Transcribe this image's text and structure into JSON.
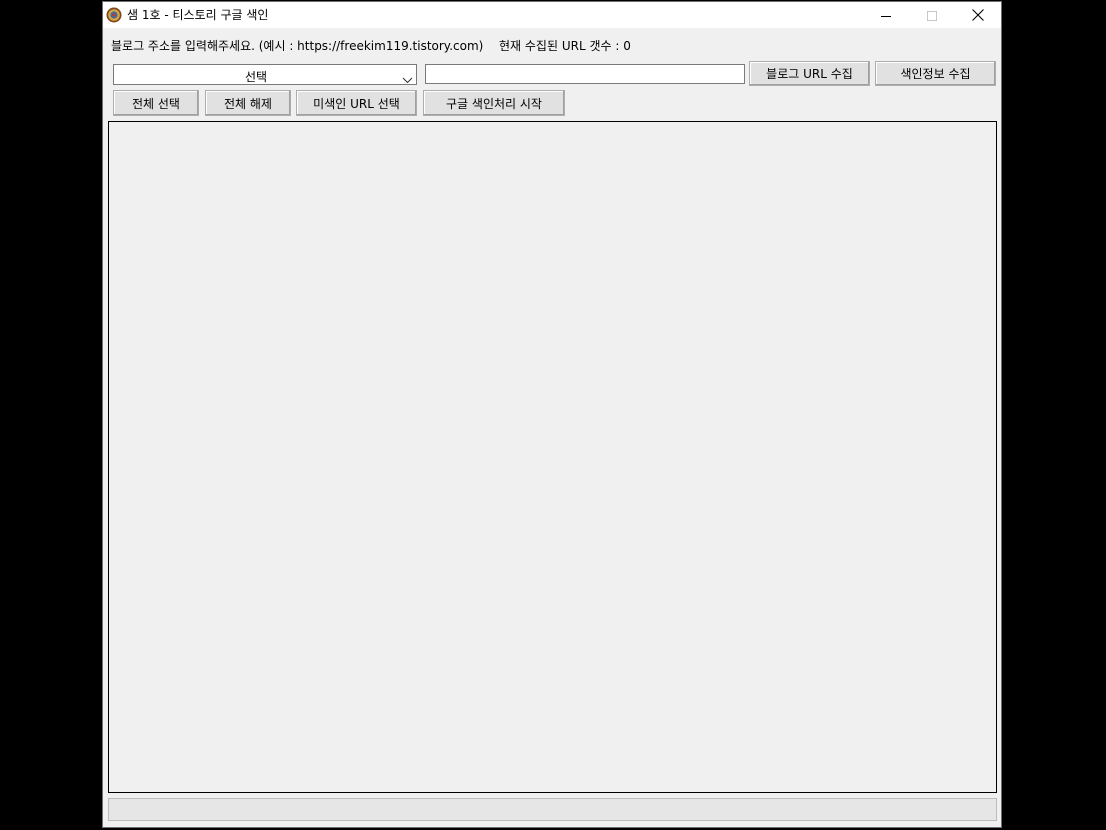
{
  "window": {
    "title": "샘 1호 - 티스토리 구글 색인"
  },
  "form": {
    "hint_label": "블로그 주소를 입력해주세요. (예시 : https://freekim119.tistory.com)",
    "count_label": "현재 수집된 URL 갯수 : 0",
    "combo_selected": "선택",
    "url_value": "",
    "url_placeholder": ""
  },
  "buttons": {
    "collect_url": "블로그 URL 수집",
    "collect_index": "색인정보 수집",
    "select_all": "전체 선택",
    "deselect_all": "전체 해제",
    "select_unindexed": "미색인 URL 선택",
    "start_index": "구글 색인처리 시작"
  },
  "icons": {
    "app": "app-emblem-icon",
    "minimize": "minimize-icon",
    "maximize": "maximize-icon",
    "close": "close-icon",
    "dropdown": "chevron-down-icon"
  },
  "colors": {
    "window_bg": "#f0f0f0",
    "titlebar_bg": "#ffffff",
    "button_bg": "#e1e1e1",
    "desktop_bg": "#000000"
  }
}
